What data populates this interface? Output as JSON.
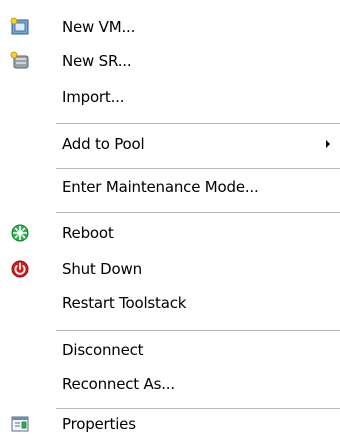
{
  "menu": {
    "items": [
      {
        "label": "New VM...",
        "icon": "new-vm-icon"
      },
      {
        "label": "New SR...",
        "icon": "new-sr-icon"
      },
      {
        "label": "Import..."
      },
      {
        "label": "Add to Pool",
        "submenu": true
      },
      {
        "label": "Enter Maintenance Mode..."
      },
      {
        "label": "Reboot",
        "icon": "reboot-icon"
      },
      {
        "label": "Shut Down",
        "icon": "shutdown-icon"
      },
      {
        "label": "Restart Toolstack"
      },
      {
        "label": "Disconnect"
      },
      {
        "label": "Reconnect As..."
      },
      {
        "label": "Properties",
        "icon": "properties-icon"
      }
    ]
  },
  "colors": {
    "separator": "#b9b9b9",
    "reboot": "#2bb24c",
    "shutdown": "#d91a1a"
  }
}
